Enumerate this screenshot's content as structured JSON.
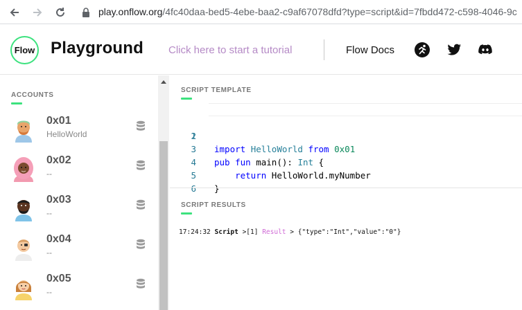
{
  "browser": {
    "url_host": "play.onflow.org",
    "url_path": "/4fc40daa-bed5-4ebe-baa2-c9af67078dfd?type=script&id=7fbdd472-c598-4046-9c"
  },
  "header": {
    "logo_text": "Flow",
    "title": "Playground",
    "tutorial_link": "Click here to start a tutorial",
    "docs_link": "Flow Docs"
  },
  "sidebar": {
    "section_label": "ACCOUNTS",
    "accounts": [
      {
        "address": "0x01",
        "name": "HelloWorld"
      },
      {
        "address": "0x02",
        "name": "--"
      },
      {
        "address": "0x03",
        "name": "--"
      },
      {
        "address": "0x04",
        "name": "--"
      },
      {
        "address": "0x05",
        "name": "--"
      }
    ]
  },
  "script": {
    "section_label": "SCRIPT TEMPLATE",
    "line_numbers": [
      "1",
      "2",
      "3",
      "4",
      "5",
      "6"
    ],
    "line1": {
      "kw": "import",
      "name": "HelloWorld",
      "from": "from",
      "addr": "0x01"
    },
    "line3": {
      "kw1": "pub",
      "kw2": "fun",
      "sig": "main():",
      "type": "Int",
      "brace": "{"
    },
    "line4": {
      "kw": "return",
      "expr": "HelloWorld.myNumber"
    },
    "line5": "}"
  },
  "results": {
    "section_label": "SCRIPT RESULTS",
    "time": "17:24:32",
    "kind": "Script",
    "prefix": ">[1]",
    "result_word": "Result",
    "arrow": ">",
    "value": "{\"type\":\"Int\",\"value\":\"0\"}"
  },
  "colors": {
    "accent": "#3ce27e",
    "tutorial": "#b58ac6"
  }
}
